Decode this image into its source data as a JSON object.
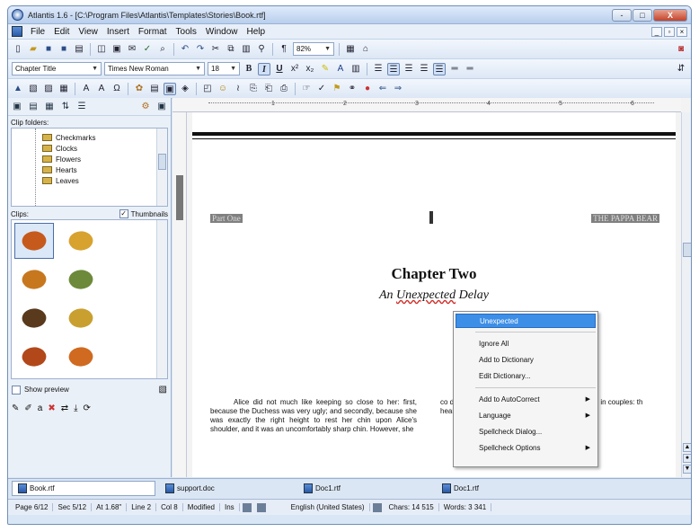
{
  "window": {
    "title": "Atlantis 1.6 - [C:\\Program Files\\Atlantis\\Templates\\Stories\\Book.rtf]",
    "controls": [
      "-",
      "□",
      "X"
    ]
  },
  "menu": [
    "File",
    "Edit",
    "View",
    "Insert",
    "Format",
    "Tools",
    "Window",
    "Help"
  ],
  "toolbar2": {
    "style": "Chapter Title",
    "font": "Times New Roman",
    "size": "18",
    "zoom": "82%"
  },
  "left_panel": {
    "clip_folders_label": "Clip folders:",
    "folders": [
      "Checkmarks",
      "Clocks",
      "Flowers",
      "Hearts",
      "Leaves"
    ],
    "clips_label": "Clips:",
    "thumbnails_label": "Thumbnails",
    "show_preview_label": "Show preview",
    "clips": [
      {
        "color": "#c65a1c"
      },
      {
        "color": "#d7a22e"
      },
      {
        "color": "#c7781f"
      },
      {
        "color": "#6c8a3a"
      },
      {
        "color": "#5a3a1d"
      },
      {
        "color": "#c9a030"
      },
      {
        "color": "#b2481a"
      },
      {
        "color": "#d06a20"
      }
    ]
  },
  "ruler_numbers": [
    "1",
    "2",
    "3",
    "4",
    "5",
    "6"
  ],
  "document": {
    "header_left": "Part One",
    "header_right": "THE PAPPA BEAR",
    "chapter": "Chapter Two",
    "subtitle_pre": "An ",
    "subtitle_err": "Unexpected",
    "subtitle_post": " Delay",
    "body_left": "Alice did not much like keeping so close to her: first, because the Duchess was very ugly; and secondly, because she was exactly the right height to rest her chin upon Alice's shoulder, and it was an uncomfortably sharp chin. However, she",
    "body_right": "co                         d two and tw                       these came th                         ten of th                         e jumping in                          couples: th                          hearts."
  },
  "context_menu": {
    "suggestion": "Unexpected",
    "items": [
      "Ignore All",
      "Add to Dictionary",
      "Edit Dictionary..."
    ],
    "items2": [
      "Add to AutoCorrect",
      "Language",
      "Spellcheck Dialog...",
      "Spellcheck Options"
    ]
  },
  "tabs": [
    "Book.rtf",
    "support.doc",
    "Doc1.rtf",
    "Doc1.rtf"
  ],
  "status": {
    "page": "Page 6/12",
    "sec": "Sec 5/12",
    "at": "At 1.68\"",
    "line": "Line 2",
    "col": "Col 8",
    "modified": "Modified",
    "ins": "Ins",
    "lang": "English (United States)",
    "chars": "Chars: 14 515",
    "words": "Words: 3 341"
  }
}
